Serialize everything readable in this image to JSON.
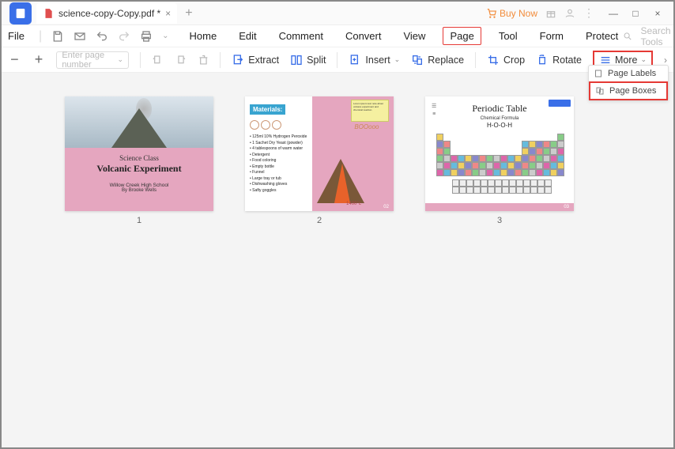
{
  "titlebar": {
    "tab_title": "science-copy-Copy.pdf *",
    "buy_now": "Buy Now"
  },
  "menubar": {
    "file": "File",
    "items": [
      "Home",
      "Edit",
      "Comment",
      "Convert",
      "View",
      "Page",
      "Tool",
      "Form",
      "Protect"
    ],
    "active": "Page",
    "search_placeholder": "Search Tools"
  },
  "toolbar": {
    "page_placeholder": "Enter page number",
    "extract": "Extract",
    "split": "Split",
    "insert": "Insert",
    "replace": "Replace",
    "crop": "Crop",
    "rotate": "Rotate",
    "more": "More"
  },
  "dropdown": {
    "page_labels": "Page Labels",
    "page_boxes": "Page Boxes"
  },
  "thumbs": {
    "p1": {
      "line1": "Science Class",
      "line2": "Volcanic Experiment",
      "line3": "Willow Creek High School",
      "line4": "By Brooke Wells",
      "num": "1"
    },
    "p2": {
      "materials": "Materials:",
      "list": "• 125ml 10% Hydrogen Peroxide\n• 1 Sachet Dry Yeast (powder)\n• 4 tablespoons of warm water\n• Detergent\n• Food coloring\n• Empty bottle\n• Funnel\n• Large tray or tub\n• Dishwashing gloves\n• Safty goggles",
      "boom": "BOOooo",
      "temp": "1400°c",
      "pagenum": "02",
      "num": "2"
    },
    "p3": {
      "title": "Periodic Table",
      "subtitle": "Chemical Formula",
      "formula": "H-O-O-H",
      "pagenum": "03",
      "num": "3"
    }
  }
}
